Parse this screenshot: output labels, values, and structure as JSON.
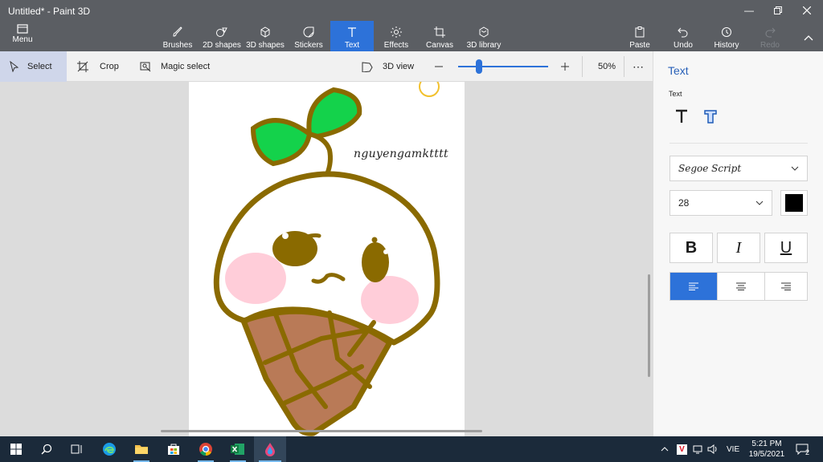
{
  "window": {
    "title": "Untitled* - Paint 3D"
  },
  "ribbon": {
    "menu_label": "Menu",
    "tools": [
      {
        "label": "Brushes",
        "icon": "brush-icon"
      },
      {
        "label": "2D shapes",
        "icon": "2d-shapes-icon"
      },
      {
        "label": "3D shapes",
        "icon": "3d-shapes-icon"
      },
      {
        "label": "Stickers",
        "icon": "stickers-icon"
      },
      {
        "label": "Text",
        "icon": "text-icon",
        "active": true
      },
      {
        "label": "Effects",
        "icon": "effects-icon"
      },
      {
        "label": "Canvas",
        "icon": "canvas-icon"
      },
      {
        "label": "3D library",
        "icon": "3d-library-icon"
      }
    ],
    "right_tools": [
      {
        "label": "Paste",
        "icon": "paste-icon"
      },
      {
        "label": "Undo",
        "icon": "undo-icon"
      },
      {
        "label": "History",
        "icon": "history-icon"
      },
      {
        "label": "Redo",
        "icon": "redo-icon",
        "disabled": true
      }
    ]
  },
  "toolbar": {
    "select_label": "Select",
    "crop_label": "Crop",
    "magic_select_label": "Magic select",
    "view3d_label": "3D view",
    "zoom_value": "50%",
    "zoom_level": 0.5
  },
  "canvas": {
    "signature_text": "nguyengamktttt",
    "colors": {
      "outline": "#8a6a00",
      "leaf": "#14d24b",
      "cone": "#b97a57",
      "blush": "#ffb6c8"
    }
  },
  "panel": {
    "title": "Text",
    "subtitle": "Text",
    "font": "Segoe Script",
    "size": "28",
    "color": "#000000",
    "bold_label": "B",
    "italic_label": "I",
    "underline_label": "U",
    "alignment": "left"
  },
  "taskbar": {
    "apps": [
      "windows-start-icon",
      "search-icon",
      "task-view-icon",
      "edge-icon",
      "file-explorer-icon",
      "store-icon",
      "chrome-icon",
      "excel-icon",
      "paint3d-icon"
    ],
    "language": "VIE",
    "time": "5:21 PM",
    "date": "19/5/2021",
    "notifications": "2"
  }
}
